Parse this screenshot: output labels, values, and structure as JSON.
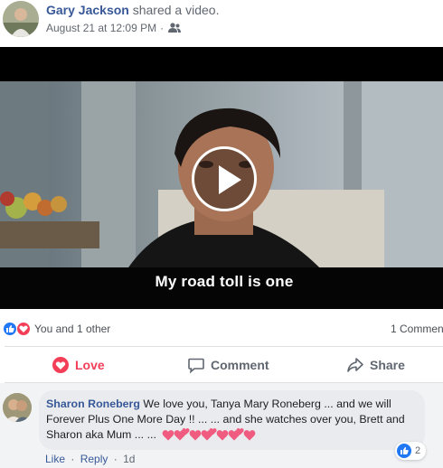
{
  "post": {
    "author": "Gary Jackson",
    "action": "shared a video.",
    "timestamp": "August 21 at 12:09 PM",
    "separator": "·",
    "audience_icon": "friends-icon"
  },
  "video": {
    "subtitle": "My road toll is one",
    "play_icon": "play-icon"
  },
  "reactions": {
    "summary": "You and 1 other",
    "comments_count": "1 Commen",
    "types": [
      "like",
      "love"
    ],
    "colors": {
      "like": "#2078f4",
      "love": "#f33e58"
    }
  },
  "actions": {
    "love_label": "Love",
    "comment_label": "Comment",
    "share_label": "Share"
  },
  "comment": {
    "author": "Sharon Roneberg",
    "text": " We love you, Tanya Mary Roneberg ... and we will Forever Plus One More Day !! ... ... and she watches over you, Brett and Sharon aka Mum ... ...",
    "emoji": "pink hearts",
    "reaction_count": "2",
    "like_label": "Like",
    "reply_label": "Reply",
    "time": "1d",
    "separator": "·"
  }
}
